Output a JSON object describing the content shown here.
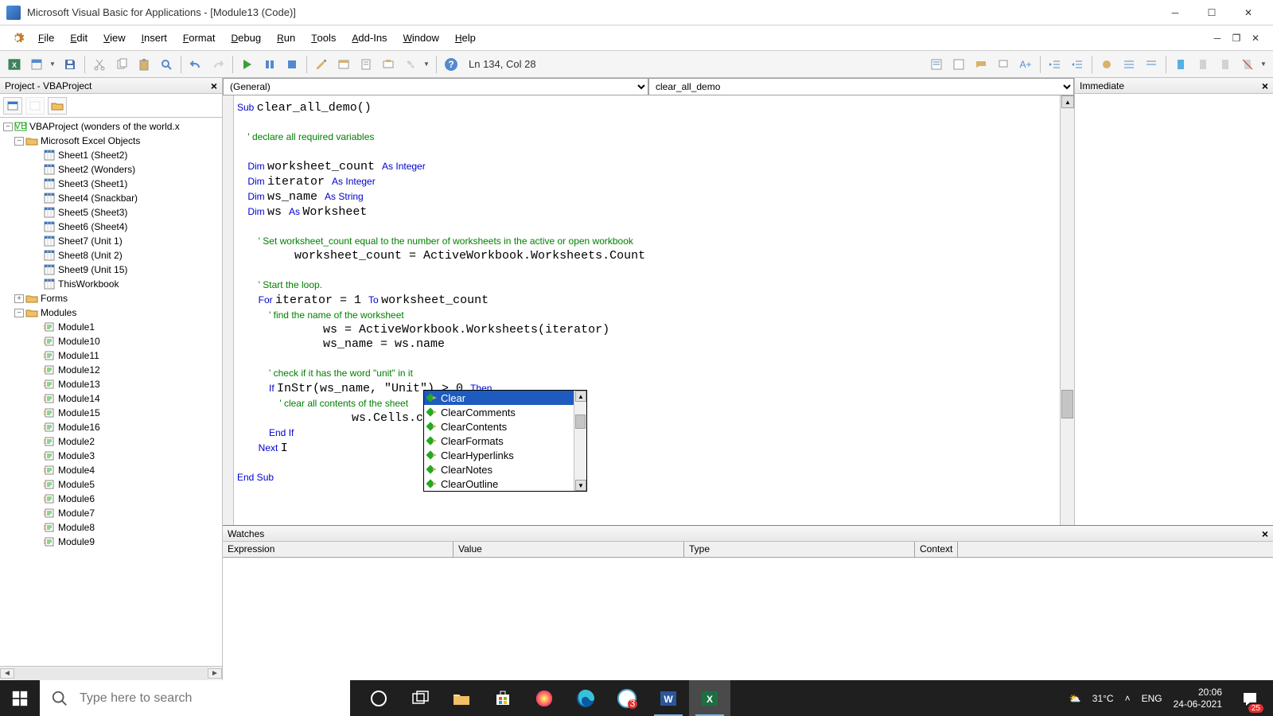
{
  "title": "Microsoft Visual Basic for Applications - [Module13 (Code)]",
  "menubar": [
    "File",
    "Edit",
    "View",
    "Insert",
    "Format",
    "Debug",
    "Run",
    "Tools",
    "Add-Ins",
    "Window",
    "Help"
  ],
  "cursor_pos": "Ln 134, Col 28",
  "project": {
    "title": "Project - VBAProject",
    "root": "VBAProject (wonders of the world.x",
    "excel_objects_label": "Microsoft Excel Objects",
    "sheets": [
      "Sheet1 (Sheet2)",
      "Sheet2 (Wonders)",
      "Sheet3 (Sheet1)",
      "Sheet4 (Snackbar)",
      "Sheet5 (Sheet3)",
      "Sheet6 (Sheet4)",
      "Sheet7 (Unit 1)",
      "Sheet8 (Unit 2)",
      "Sheet9 (Unit 15)",
      "ThisWorkbook"
    ],
    "forms_label": "Forms",
    "modules_label": "Modules",
    "modules": [
      "Module1",
      "Module10",
      "Module11",
      "Module12",
      "Module13",
      "Module14",
      "Module15",
      "Module16",
      "Module2",
      "Module3",
      "Module4",
      "Module5",
      "Module6",
      "Module7",
      "Module8",
      "Module9"
    ]
  },
  "editor": {
    "left_combo": "(General)",
    "right_combo": "clear_all_demo",
    "code_lines": [
      {
        "t": "kw",
        "s": "Sub ",
        "r": "clear_all_demo()"
      },
      {
        "t": "blank"
      },
      {
        "t": "cm",
        "s": "    ' declare all required variables"
      },
      {
        "t": "blank"
      },
      {
        "t": "dim",
        "a": "    Dim ",
        "b": "worksheet_count ",
        "c": "As Integer"
      },
      {
        "t": "dim",
        "a": "    Dim ",
        "b": "iterator ",
        "c": "As Integer"
      },
      {
        "t": "dim",
        "a": "    Dim ",
        "b": "ws_name ",
        "c": "As String"
      },
      {
        "t": "dim",
        "a": "    Dim ",
        "b": "ws ",
        "c": "As ",
        "d": "Worksheet"
      },
      {
        "t": "blank"
      },
      {
        "t": "cm",
        "s": "        ' Set worksheet_count equal to the number of worksheets in the active or open workbook"
      },
      {
        "t": "plain",
        "s": "        worksheet_count = ActiveWorkbook.Worksheets.Count"
      },
      {
        "t": "blank"
      },
      {
        "t": "cm",
        "s": "        ' Start the loop."
      },
      {
        "t": "for",
        "a": "        For ",
        "b": "iterator = 1 ",
        "c": "To ",
        "d": "worksheet_count"
      },
      {
        "t": "cm",
        "s": "            ' find the name of the worksheet"
      },
      {
        "t": "plain",
        "s": "            ws = ActiveWorkbook.Worksheets(iterator)"
      },
      {
        "t": "plain",
        "s": "            ws_name = ws.name"
      },
      {
        "t": "blank"
      },
      {
        "t": "cm",
        "s": "            ' check if it has the word \"unit\" in it"
      },
      {
        "t": "if",
        "a": "            If ",
        "b": "InStr(ws_name, \"Unit\") > 0 ",
        "c": "Then"
      },
      {
        "t": "cm",
        "s": "                ' clear all contents of the sheet"
      },
      {
        "t": "plain",
        "s": "                ws.Cells.cl"
      },
      {
        "t": "endif",
        "s": "            End If"
      },
      {
        "t": "next",
        "a": "        Next ",
        "b": "I"
      },
      {
        "t": "blank"
      },
      {
        "t": "endsub",
        "s": "End Sub"
      }
    ]
  },
  "intellisense": [
    "Clear",
    "ClearComments",
    "ClearContents",
    "ClearFormats",
    "ClearHyperlinks",
    "ClearNotes",
    "ClearOutline"
  ],
  "immediate_title": "Immediate",
  "watches": {
    "title": "Watches",
    "cols": [
      "Expression",
      "Value",
      "Type",
      "Context"
    ]
  },
  "taskbar": {
    "search_placeholder": "Type here to search",
    "temp": "31°C",
    "lang": "ENG",
    "time": "20:06",
    "date": "24-06-2021",
    "notif_count": "25"
  }
}
